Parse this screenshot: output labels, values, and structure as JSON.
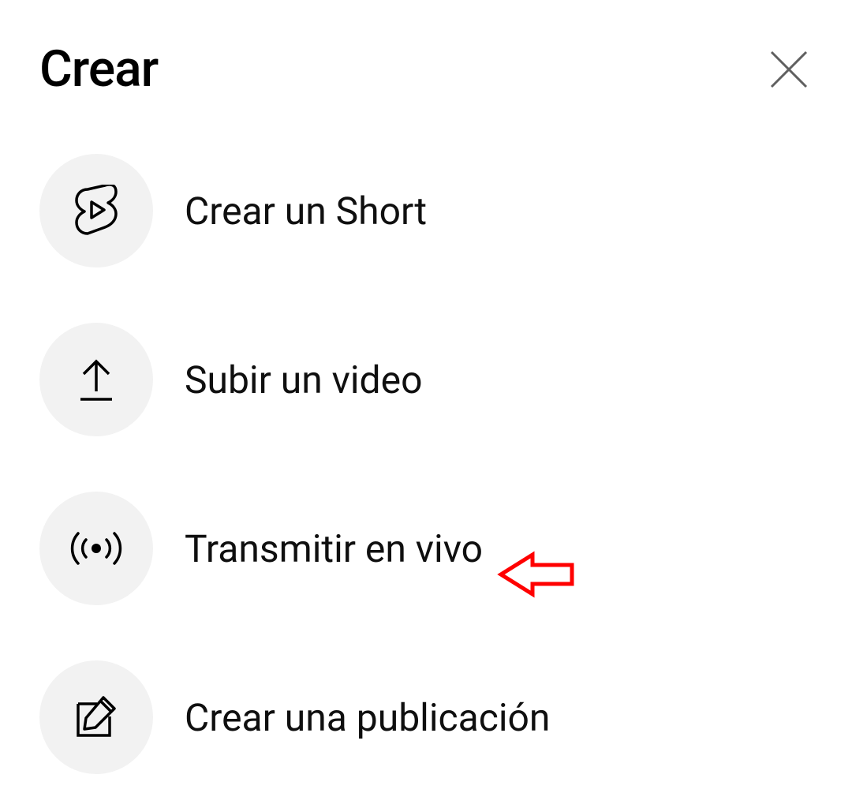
{
  "header": {
    "title": "Crear"
  },
  "menu": {
    "items": [
      {
        "label": "Crear un Short",
        "icon": "shorts-icon"
      },
      {
        "label": "Subir un video",
        "icon": "upload-icon"
      },
      {
        "label": "Transmitir en vivo",
        "icon": "live-icon"
      },
      {
        "label": "Crear una publicación",
        "icon": "post-icon"
      }
    ]
  },
  "annotation": {
    "highlighted_item_index": 2,
    "color": "#ff0000"
  }
}
